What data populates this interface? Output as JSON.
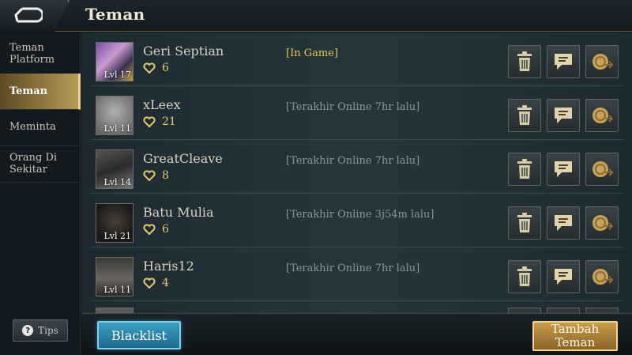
{
  "header": {
    "title": "Teman"
  },
  "sidebar": {
    "items": [
      {
        "label": "Teman Platform",
        "active": false
      },
      {
        "label": "Teman",
        "active": true
      },
      {
        "label": "Meminta",
        "active": false
      },
      {
        "label": "Orang Di Sekitar",
        "active": false
      }
    ],
    "tips_label": "Tips"
  },
  "friends": [
    {
      "name": "Geri Septian",
      "likes": "6",
      "level": "Lvl 17",
      "status": "[In Game]",
      "in_game": true
    },
    {
      "name": "xLeex",
      "likes": "21",
      "level": "Lvl 11",
      "status": "[Terakhir Online 7hr lalu]",
      "in_game": false
    },
    {
      "name": "GreatCleave",
      "likes": "8",
      "level": "Lvl 14",
      "status": "[Terakhir Online 7hr lalu]",
      "in_game": false
    },
    {
      "name": "Batu Mulia",
      "likes": "6",
      "level": "Lvl 21",
      "status": "[Terakhir Online 3j54m lalu]",
      "in_game": false
    },
    {
      "name": "Haris12",
      "likes": "4",
      "level": "Lvl 11",
      "status": "[Terakhir Online 7hr lalu]",
      "in_game": false
    }
  ],
  "footer": {
    "blacklist_label": "Blacklist",
    "add_friend_label": "Tambah Teman"
  },
  "colors": {
    "accent_gold": "#b89a5a",
    "in_game_status": "#e8c64c",
    "like_gold": "#e8c86a",
    "blacklist_blue": "#2f8bb0"
  }
}
